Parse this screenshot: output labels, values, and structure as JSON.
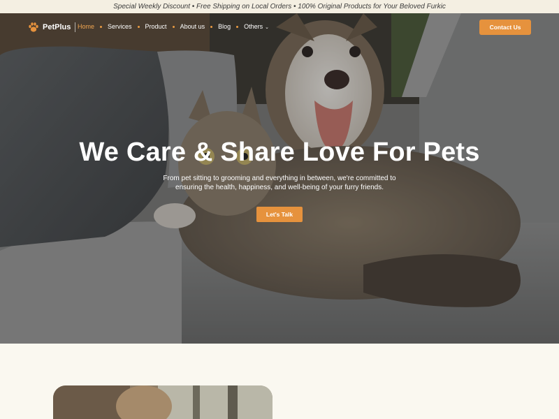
{
  "announcement": "Special Weekly Discount • Free Shipping on Local Orders • 100% Original Products for Your Beloved Furkic",
  "brand": {
    "name": "PetPlus",
    "icon": "paw-icon"
  },
  "nav": {
    "items": [
      {
        "label": "Home",
        "active": true
      },
      {
        "label": "Services"
      },
      {
        "label": "Product"
      },
      {
        "label": "About us"
      },
      {
        "label": "Blog"
      },
      {
        "label": "Others",
        "dropdown": true
      }
    ],
    "contact_label": "Contact Us"
  },
  "hero": {
    "title": "We Care & Share Love For Pets",
    "subtitle": "From pet sitting to grooming and everything in between, we're committed to ensuring the health, happiness, and well-being of your furry friends.",
    "cta_label": "Let's Talk"
  },
  "colors": {
    "accent": "#e6923d",
    "active_link": "#f0a550",
    "page_bg": "#faf8f0",
    "topbar_bg": "#f4efe2"
  }
}
